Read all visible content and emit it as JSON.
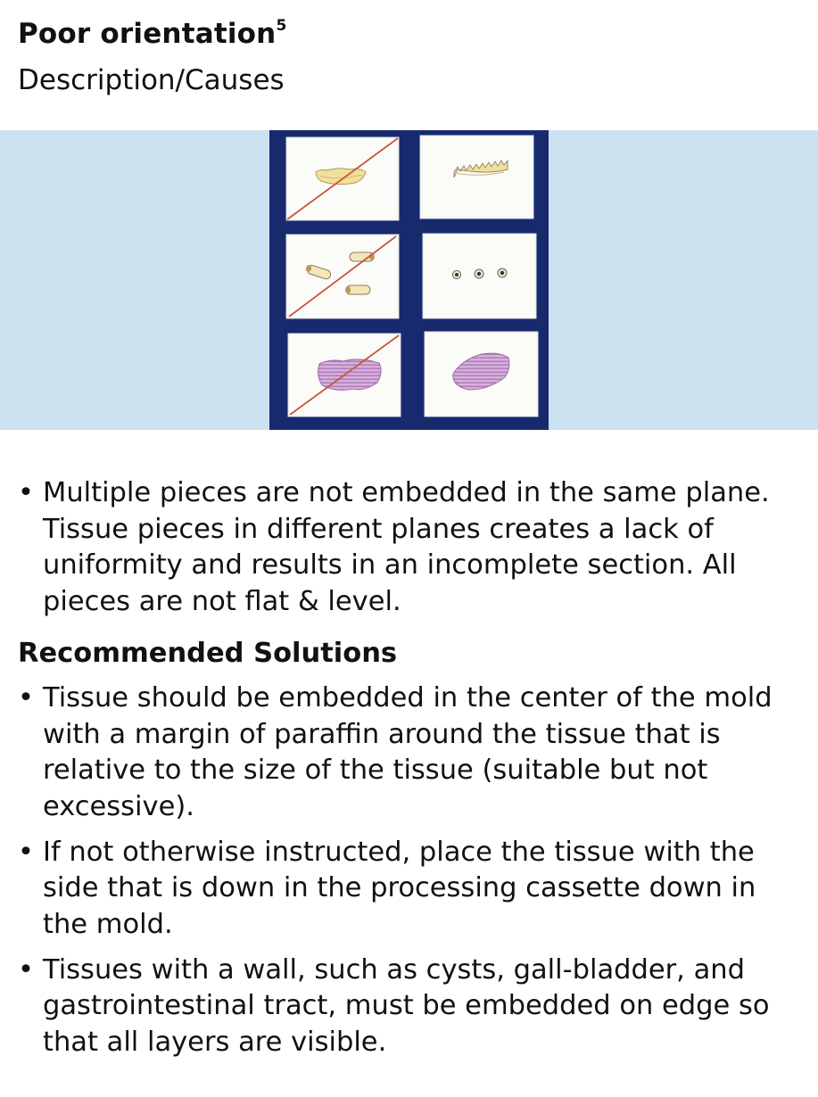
{
  "header": {
    "title": "Poor orientation",
    "title_superscript": "5",
    "subtitle": "Description/Causes"
  },
  "figure": {
    "band_color": "#cde2f1",
    "board_color": "#172a6e",
    "strike_color": "#c8553f",
    "panels": [
      {
        "row": 1,
        "column": 1,
        "content": "tooth-section-flat",
        "crossed_out": true
      },
      {
        "row": 1,
        "column": 2,
        "content": "tooth-section-on-edge",
        "crossed_out": false
      },
      {
        "row": 2,
        "column": 1,
        "content": "tube-pieces-lying",
        "crossed_out": true
      },
      {
        "row": 2,
        "column": 2,
        "content": "tube-cross-sections",
        "crossed_out": false
      },
      {
        "row": 3,
        "column": 1,
        "content": "layered-tissue-flat",
        "crossed_out": true
      },
      {
        "row": 3,
        "column": 2,
        "content": "layered-tissue-on-edge",
        "crossed_out": false
      }
    ]
  },
  "causes": [
    "Multiple pieces are not embedded in the same plane. Tissue pieces in different planes creates a lack of uniformity and results in an incomplete section. All pieces are not flat & level."
  ],
  "solutions_heading": "Recommended Solutions",
  "solutions": [
    "Tissue should be embedded in the center of the mold with a margin of paraffin around the tissue that is relative to the size of the tissue (suitable but not excessive).",
    "If not otherwise instructed, place the tissue with the side that is down in the processing cassette down in the mold.",
    "Tissues with a wall, such as cysts, gall-bladder, and gastrointestinal tract, must be embedded on edge so that all layers are visible."
  ]
}
